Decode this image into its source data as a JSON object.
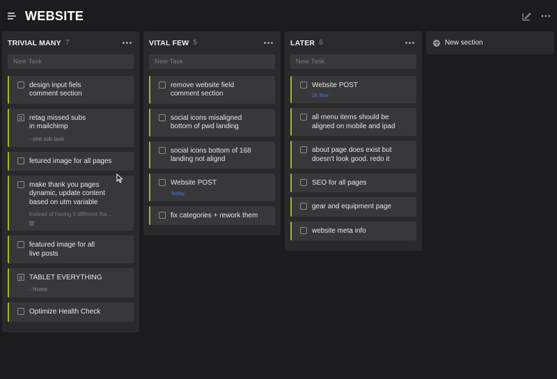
{
  "header": {
    "title": "WEBSITE",
    "menu_icon": "hamburger-menu-icon",
    "right_icons": [
      "edit-icon",
      "more-icon"
    ]
  },
  "colors": {
    "background": "#1c1c1f",
    "column": "#2a2a2d",
    "card": "#38383b",
    "accent": "#9bbd2a",
    "date_blue": "#4a78d6"
  },
  "columns": [
    {
      "title": "TRIVIAL MANY",
      "count": "7",
      "new_task_placeholder": "New Task",
      "cards": [
        {
          "title": "design input fiels\ncomment section",
          "type": "checkbox"
        },
        {
          "title": "retag missed subs\nin mailchimp",
          "type": "subtasks",
          "sub": "- one sub task"
        },
        {
          "title": "fetured image for all pages",
          "type": "checkbox"
        },
        {
          "title": "make thank you pages\ndynamic, update content\nbased on utm variable",
          "type": "checkbox",
          "desc": "instead of having 5 different tha..."
        },
        {
          "title": "featured image for all\nlive posts",
          "type": "checkbox"
        },
        {
          "title": "TABLET EVERYTHING",
          "type": "subtasks",
          "sub": "- Home"
        },
        {
          "title": "Optimize Health Check",
          "type": "checkbox"
        }
      ]
    },
    {
      "title": "VITAL FEW",
      "count": "5",
      "new_task_placeholder": "New Task",
      "cards": [
        {
          "title": "remove website field\ncomment section",
          "type": "checkbox"
        },
        {
          "title": "social icons misaligned\nbottom of pwd landing",
          "type": "checkbox"
        },
        {
          "title": "social icons bottom of 168\nlanding not alignd",
          "type": "checkbox"
        },
        {
          "title": "Website POST",
          "type": "checkbox",
          "date": "Today"
        },
        {
          "title": "fix categories + rework them",
          "type": "checkbox"
        }
      ]
    },
    {
      "title": "LATER",
      "count": "6",
      "new_task_placeholder": "New Task",
      "cards": [
        {
          "title": "Website POST",
          "type": "checkbox",
          "date": "26 Nov"
        },
        {
          "title": "all menu items should be\naligned on mobile and ipad",
          "type": "checkbox"
        },
        {
          "title": "about page does exist but\ndoesn't look good. redo it",
          "type": "checkbox"
        },
        {
          "title": "SEO for all pages",
          "type": "checkbox"
        },
        {
          "title": "gear and equipment page",
          "type": "checkbox"
        },
        {
          "title": "website meta info",
          "type": "checkbox"
        }
      ]
    }
  ],
  "new_section": {
    "label": "New section",
    "icon": "plus-circle-icon"
  }
}
